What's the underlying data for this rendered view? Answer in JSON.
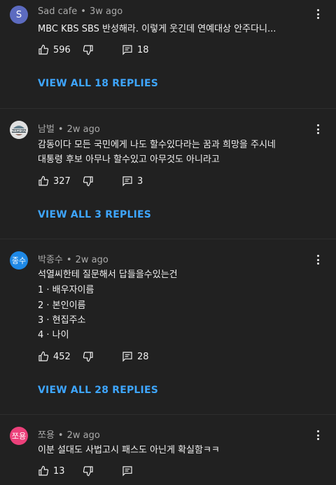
{
  "comments": [
    {
      "author": "Sad cafe",
      "time": "3w ago",
      "avatar": {
        "letter": "S",
        "color": "#5c6bc0"
      },
      "lines": [
        "MBC KBS SBS 반성해라. 이렇게 웃긴데 연예대상 안주다니..."
      ],
      "likes": "596",
      "replies_count": "18",
      "view_replies": "VIEW ALL 18 REPLIES"
    },
    {
      "author": "남벌",
      "time": "2w ago",
      "avatar": {
        "letter": "NAMBUL",
        "color": "#cfd8dc"
      },
      "lines": [
        "감동이다 모든 국민에게 나도 할수있다라는 꿈과 희망을 주시네",
        "대통령 후보 아무나 할수있고 아무것도 아니라고"
      ],
      "likes": "327",
      "replies_count": "3",
      "view_replies": "VIEW ALL 3 REPLIES"
    },
    {
      "author": "박종수",
      "time": "2w ago",
      "avatar": {
        "letter": "종수",
        "color": "#1e88e5"
      },
      "lines": [
        "석열씨한테 질문해서 답들을수있는건",
        "1 · 배우자이름",
        "2 · 본인이름",
        "3 · 현집주소",
        "4 · 나이"
      ],
      "likes": "452",
      "replies_count": "28",
      "view_replies": "VIEW ALL 28 REPLIES"
    },
    {
      "author": "쪼용",
      "time": "2w ago",
      "avatar": {
        "letter": "쪼용",
        "color": "#ec407a"
      },
      "lines": [
        "이분 설대도 사법고시 패스도 아닌게 확실함ㅋㅋ"
      ],
      "likes": "13",
      "replies_count": ""
    }
  ],
  "icons": {
    "like": "thumbs-up-icon",
    "dislike": "thumbs-down-icon",
    "reply": "comment-icon",
    "menu": "more-vert-icon"
  },
  "colors": {
    "background": "#212121",
    "link": "#3ea6ff",
    "secondary_text": "#aaaaaa"
  }
}
